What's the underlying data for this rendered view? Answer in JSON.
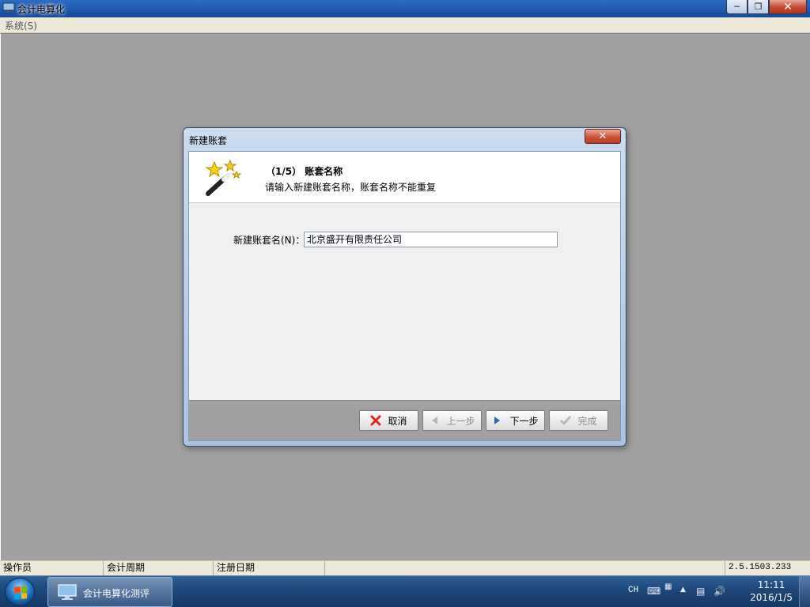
{
  "window": {
    "title": "会计电算化",
    "menu": [
      "系统(S)"
    ]
  },
  "dialog": {
    "title": "新建账套",
    "close_label": "x",
    "step_title": "（1/5） 账套名称",
    "step_subtitle": "请输入新建账套名称，账套名称不能重复",
    "field_label": "新建账套名(N)：",
    "field_value": "北京盛开有限责任公司",
    "buttons": {
      "cancel": "取消",
      "prev": "上一步",
      "next": "下一步",
      "finish": "完成"
    }
  },
  "statusbar": {
    "operator": "操作员",
    "period": "会计周期",
    "reg_date": "注册日期",
    "version": "2.5.1503.233"
  },
  "taskbar": {
    "app_label": "会计电算化测评",
    "lang": "CH",
    "time": "11:11",
    "date": "2016/1/5"
  },
  "colors": {
    "workspace": "#a0a0a0",
    "cancel_icon": "#d9261c",
    "next_icon": "#2f63b8"
  }
}
